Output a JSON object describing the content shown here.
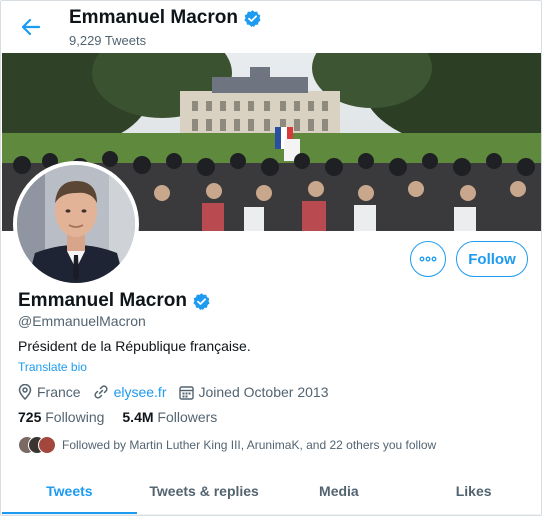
{
  "colors": {
    "accent": "#1d9bf0",
    "text": "#0f1419",
    "muted": "#536471"
  },
  "header": {
    "back_icon": "arrow-left-icon",
    "name": "Emmanuel Macron",
    "verified_icon": "verified-badge-icon",
    "tweet_count": "9,229 Tweets"
  },
  "actions": {
    "more_icon": "more-options-icon",
    "follow_label": "Follow"
  },
  "profile": {
    "name": "Emmanuel Macron",
    "handle": "@EmmanuelMacron",
    "bio": "Président de la République française.",
    "translate_label": "Translate bio",
    "location": "France",
    "website": "elysee.fr",
    "joined": "Joined October 2013",
    "following_count": "725",
    "following_label": "Following",
    "followers_count": "5.4M",
    "followers_label": "Followers",
    "followed_by": "Followed by Martin Luther King III, ArunimaK, and 22 others you follow"
  },
  "tabs": [
    {
      "label": "Tweets",
      "active": true
    },
    {
      "label": "Tweets & replies",
      "active": false
    },
    {
      "label": "Media",
      "active": false
    },
    {
      "label": "Likes",
      "active": false
    }
  ]
}
